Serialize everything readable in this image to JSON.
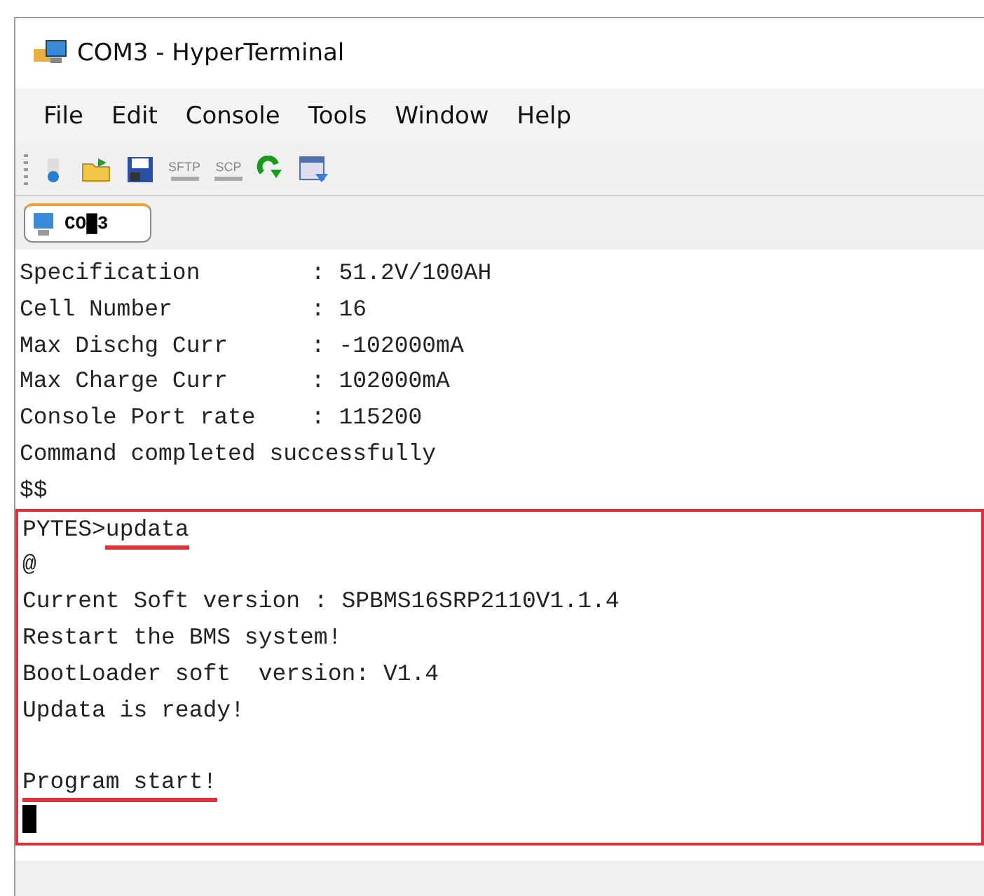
{
  "window": {
    "title": "COM3 - HyperTerminal"
  },
  "menu": [
    "File",
    "Edit",
    "Console",
    "Tools",
    "Window",
    "Help"
  ],
  "toolbar": [
    {
      "kind": "connect"
    },
    {
      "kind": "open"
    },
    {
      "kind": "save"
    },
    {
      "kind": "text",
      "label": "SFTP"
    },
    {
      "kind": "text",
      "label": "SCP"
    },
    {
      "kind": "refresh"
    },
    {
      "kind": "properties"
    }
  ],
  "tabs": [
    {
      "label": "CO█3",
      "selected": true
    }
  ],
  "terminal": {
    "lines": [
      {
        "kind": "text",
        "text": "Specification        : 51.2V/100AH"
      },
      {
        "kind": "text",
        "text": "Cell Number          : 16"
      },
      {
        "kind": "text",
        "text": "Max Dischg Curr      : -102000mA"
      },
      {
        "kind": "text",
        "text": "Max Charge Curr      : 102000mA"
      },
      {
        "kind": "text",
        "text": "Console Port rate    : 115200"
      },
      {
        "kind": "text",
        "text": "Command completed successfully"
      },
      {
        "kind": "text",
        "text": "$$"
      }
    ],
    "highlighted_lines": [
      {
        "kind": "command",
        "prompt": "PYTES>",
        "text": "updata",
        "underlined": true
      },
      {
        "kind": "text",
        "text": "@"
      },
      {
        "kind": "text",
        "text": "Current Soft version : SPBMS16SRP2110V1.1.4"
      },
      {
        "kind": "text",
        "text": "Restart the BMS system!"
      },
      {
        "kind": "text",
        "text": "BootLoader soft  version: V1.4"
      },
      {
        "kind": "text",
        "text": "Updata is ready!"
      },
      {
        "kind": "blank"
      },
      {
        "kind": "text",
        "text": "Program start!",
        "underlined": true
      },
      {
        "kind": "cursor"
      }
    ]
  }
}
